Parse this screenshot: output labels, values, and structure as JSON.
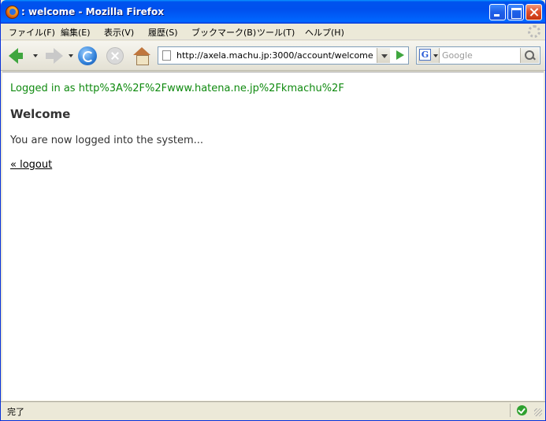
{
  "window": {
    "title": ": welcome - Mozilla Firefox"
  },
  "menubar": {
    "items": [
      "ファイル(F)",
      "編集(E)",
      "表示(V)",
      "履歴(S)",
      "ブックマーク(B)",
      "ツール(T)",
      "ヘルプ(H)"
    ]
  },
  "navbar": {
    "url": "http://axela.machu.jp:3000/account/welcome",
    "search_engine_letter": "G",
    "search_placeholder": "Google"
  },
  "page": {
    "notice": "Logged in as http%3A%2F%2Fwww.hatena.ne.jp%2Fkmachu%2F",
    "heading": "Welcome",
    "message": "You are now logged into the system...",
    "logout_label": "« logout"
  },
  "statusbar": {
    "text": "完了"
  },
  "colors": {
    "notice": "#0f8a0f",
    "titlebar": "#0050ee"
  }
}
